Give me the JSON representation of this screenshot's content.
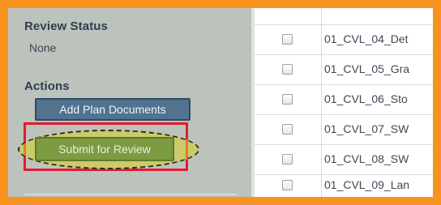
{
  "colors": {
    "frame_border": "#f7931e",
    "left_panel_bg": "#bcc3bd",
    "heading_text": "#2f3d4f",
    "add_docs_bg": "#51738f",
    "submit_bg": "#7d9b40",
    "highlight_rect": "#e8182e",
    "highlight_ellipse_fill": "#d8d024"
  },
  "sidebar": {
    "review_status": {
      "heading": "Review Status",
      "value": "None"
    },
    "actions": {
      "heading": "Actions",
      "add_plan_documents_label": "Add Plan Documents",
      "submit_for_review_label": "Submit for Review"
    }
  },
  "documents": {
    "rows": [
      {
        "name": "01_CVL_04_Det"
      },
      {
        "name": "01_CVL_05_Gra"
      },
      {
        "name": "01_CVL_06_Sto"
      },
      {
        "name": "01_CVL_07_SW"
      },
      {
        "name": "01_CVL_08_SW"
      },
      {
        "name": "01_CVL_09_Lan"
      }
    ]
  }
}
